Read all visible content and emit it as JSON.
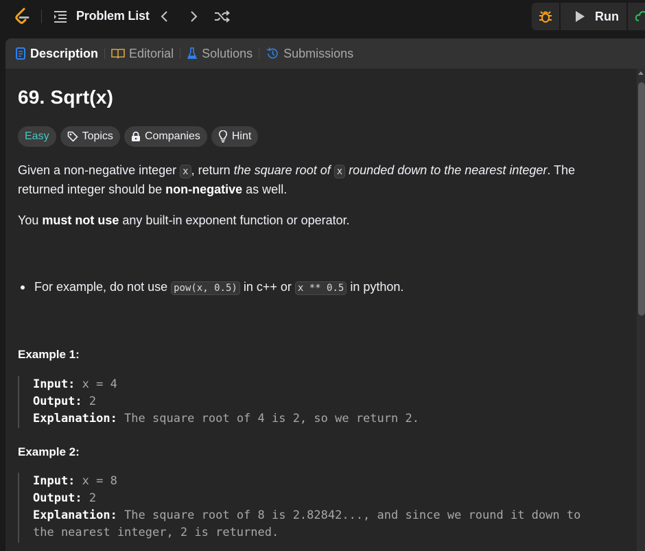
{
  "topbar": {
    "problem_list_label": "Problem List"
  },
  "actions": {
    "run_label": "Run"
  },
  "tabs": [
    {
      "label": "Description",
      "icon": "description-icon",
      "color": "#2f80ed"
    },
    {
      "label": "Editorial",
      "icon": "book-icon",
      "color": "#d9a441"
    },
    {
      "label": "Solutions",
      "icon": "flask-icon",
      "color": "#2f80ed"
    },
    {
      "label": "Submissions",
      "icon": "history-icon",
      "color": "#2f80ed"
    }
  ],
  "problem": {
    "title": "69. Sqrt(x)",
    "badges": {
      "difficulty": "Easy",
      "topics": "Topics",
      "companies": "Companies",
      "hint": "Hint"
    },
    "desc": {
      "p1_a": "Given a non-negative integer ",
      "p1_code1": "x",
      "p1_b": ", return ",
      "p1_i1": "the square root of ",
      "p1_code2": "x",
      "p1_i2": " rounded down to the nearest integer",
      "p1_c": ". The returned integer should be ",
      "p1_bold": "non-negative",
      "p1_d": " as well.",
      "p2_a": "You ",
      "p2_bold": "must not use",
      "p2_b": " any built-in exponent function or operator.",
      "bullet_a": "For example, do not use ",
      "bullet_code1": "pow(x, 0.5)",
      "bullet_b": " in c++ or ",
      "bullet_code2": "x ** 0.5",
      "bullet_c": " in python."
    },
    "examples": [
      {
        "title": "Example 1:",
        "input_key": "Input:",
        "input_val": " x = 4",
        "output_key": "Output:",
        "output_val": " 2",
        "expl_key": "Explanation:",
        "expl_val": " The square root of 4 is 2, so we return 2.",
        "expl_val2": ""
      },
      {
        "title": "Example 2:",
        "input_key": "Input:",
        "input_val": " x = 8",
        "output_key": "Output:",
        "output_val": " 2",
        "expl_key": "Explanation:",
        "expl_val": " The square root of 8 is 2.82842..., and since we round it down to",
        "expl_val2": "the nearest integer, 2 is returned."
      }
    ]
  },
  "colors": {
    "easy": "#46c6c2",
    "accent_orange": "#ffa116",
    "submit_green": "#2cbb5d"
  }
}
